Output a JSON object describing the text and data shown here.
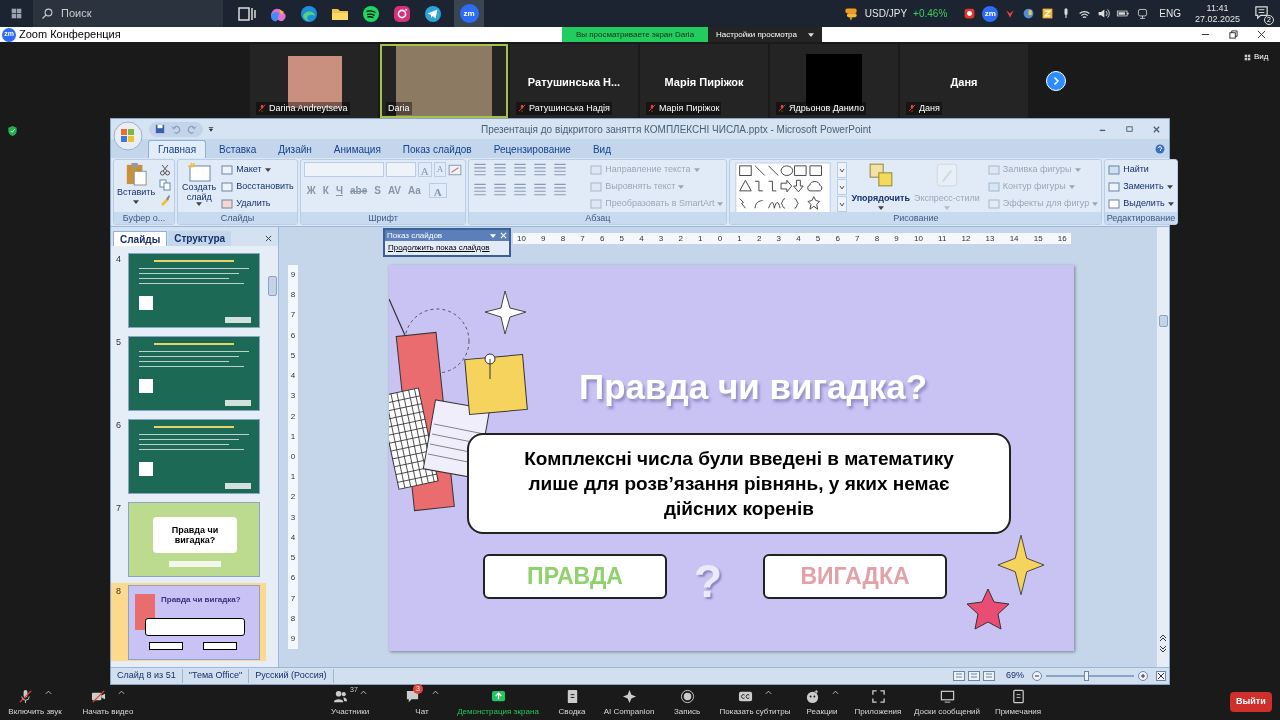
{
  "taskbar": {
    "search": {
      "placeholder": "Поиск"
    },
    "active_app_label": "zm",
    "ticker": {
      "symbol": "USD/JPY",
      "change": "+0.46%"
    },
    "tray_app_label": "zm",
    "language": "ENG",
    "time": "11:41",
    "date": "27.02.2025",
    "notification_count": "2"
  },
  "zoom": {
    "logo": "zm",
    "title": "Zoom Конференция",
    "share_banner": "Вы просматриваете экран Daria",
    "view_options": "Настройки просмотра",
    "view_button": "Вид",
    "participants": [
      {
        "kind": "photo",
        "label": "Darina Andreytseva",
        "muted": true,
        "speaking": false
      },
      {
        "kind": "video",
        "label": "Daria",
        "muted": false,
        "speaking": true
      },
      {
        "kind": "name",
        "display": "Ратушинська  Н...",
        "label": "Ратушинська Надія",
        "muted": true,
        "speaking": false
      },
      {
        "kind": "name",
        "display": "Марія Пиріжок",
        "label": "Марія Пиріжок",
        "muted": true,
        "speaking": false
      },
      {
        "kind": "blank",
        "label": "Ядрьонов Данило",
        "muted": true,
        "speaking": false
      },
      {
        "kind": "name",
        "display": "Даня",
        "label": "Даня",
        "muted": true,
        "speaking": false
      }
    ],
    "toolbar": [
      {
        "label": "Включить звук",
        "caret": true,
        "active": false
      },
      {
        "label": "Начать видео",
        "caret": true,
        "active": false
      },
      {
        "label": "Участники",
        "count": "37",
        "caret": true,
        "active": false
      },
      {
        "label": "Чат",
        "badge": "3",
        "caret": true,
        "active": false
      },
      {
        "label": "Демонстрация экрана",
        "caret": false,
        "active": true
      },
      {
        "label": "Сводка",
        "caret": false,
        "active": false
      },
      {
        "label": "AI Companion",
        "caret": false,
        "active": false
      },
      {
        "label": "Запись",
        "caret": false,
        "active": false
      },
      {
        "label": "Показать субтитры",
        "caret": true,
        "active": false
      },
      {
        "label": "Реакции",
        "caret": true,
        "active": false
      },
      {
        "label": "Приложения",
        "caret": false,
        "active": false
      },
      {
        "label": "Доски сообщений",
        "caret": false,
        "active": false
      },
      {
        "label": "Примечания",
        "caret": false,
        "active": false
      }
    ],
    "exit": "Выйти"
  },
  "powerpoint": {
    "title": "Презентація до відкритого заняття КОМПЛЕКСНІ ЧИСЛА.pptx - Microsoft PowerPoint",
    "tabs": [
      {
        "label": "Главная",
        "selected": true
      },
      {
        "label": "Вставка",
        "selected": false
      },
      {
        "label": "Дизайн",
        "selected": false
      },
      {
        "label": "Анимация",
        "selected": false
      },
      {
        "label": "Показ слайдов",
        "selected": false
      },
      {
        "label": "Рецензирование",
        "selected": false
      },
      {
        "label": "Вид",
        "selected": false
      }
    ],
    "ribbon": {
      "clipboard": {
        "paste": "Вставить",
        "label": "Буфер о..."
      },
      "slides": {
        "new_slide": "Создать слайд",
        "items": [
          {
            "label": "Макет",
            "caret": true
          },
          {
            "label": "Восстановить",
            "caret": false
          },
          {
            "label": "Удалить",
            "caret": false
          }
        ],
        "label": "Слайды"
      },
      "font": {
        "buttons": [
          "A",
          "A",
          "Ж",
          "К",
          "Ч",
          "abe",
          "S",
          "AV",
          "Aa",
          "A"
        ],
        "label": "Шрифт"
      },
      "paragraph": {
        "items": [
          {
            "label": "Направление текста",
            "disabled": true
          },
          {
            "label": "Выровнять текст",
            "disabled": true
          },
          {
            "label": "Преобразовать в SmartArt",
            "disabled": true
          }
        ],
        "label": "Абзац"
      },
      "drawing": {
        "arrange": {
          "label": "Упорядочить",
          "disabled": false
        },
        "quick_styles": {
          "label": "Экспресс-стили",
          "disabled": true
        },
        "items": [
          {
            "label": "Заливка фигуры",
            "disabled": true
          },
          {
            "label": "Контур фигуры",
            "disabled": true
          },
          {
            "label": "Эффекты для фигур",
            "disabled": true
          }
        ],
        "label": "Рисование"
      },
      "editing": {
        "items": [
          {
            "label": "Найти",
            "caret": false
          },
          {
            "label": "Заменить",
            "caret": true
          },
          {
            "label": "Выделить",
            "caret": true
          }
        ],
        "label": "Редактирование"
      }
    },
    "floating_toolbar": {
      "title": "Показ слайдов",
      "item": "Продолжить показ слайдов"
    },
    "pane_tabs": [
      {
        "label": "Слайды",
        "selected": true
      },
      {
        "label": "Структура",
        "selected": false
      }
    ],
    "thumbnails": [
      {
        "number": "4",
        "kind": "green",
        "selected": false
      },
      {
        "number": "5",
        "kind": "green",
        "selected": false
      },
      {
        "number": "6",
        "kind": "green",
        "selected": false
      },
      {
        "number": "7",
        "kind": "light",
        "title": "Правда чи вигадка?",
        "selected": false
      },
      {
        "number": "8",
        "kind": "lavender",
        "title": "Правда чи вигадка?",
        "selected": true
      }
    ],
    "ruler_h": [
      "10",
      "9",
      "8",
      "7",
      "6",
      "5",
      "4",
      "3",
      "2",
      "1",
      "0",
      "1",
      "2",
      "3",
      "4",
      "5",
      "6",
      "7",
      "8",
      "9",
      "10",
      "11",
      "12",
      "13",
      "14",
      "15",
      "16"
    ],
    "ruler_v": [
      "9",
      "8",
      "7",
      "6",
      "5",
      "4",
      "3",
      "2",
      "1",
      "0",
      "1",
      "2",
      "3",
      "4",
      "5",
      "6",
      "7",
      "8",
      "9"
    ],
    "slide": {
      "title": "Правда чи вигадка?",
      "statement": "Комплексні числа були введені в математику лише для розв’язання рівнянь, у яких немає дійсних коренів",
      "answers": [
        {
          "label": "ПРАВДА",
          "color": "#8fd16a"
        },
        {
          "label": "ВИГАДКА",
          "color": "#e3a0a6"
        }
      ],
      "separator": "?"
    },
    "status_bar": {
      "slide": "Слайд 8 из 51",
      "theme": "\"Тема Office\"",
      "language": "Русский (Россия)",
      "zoom": "69%",
      "zoom_slider": {
        "level": 0.45
      }
    }
  }
}
